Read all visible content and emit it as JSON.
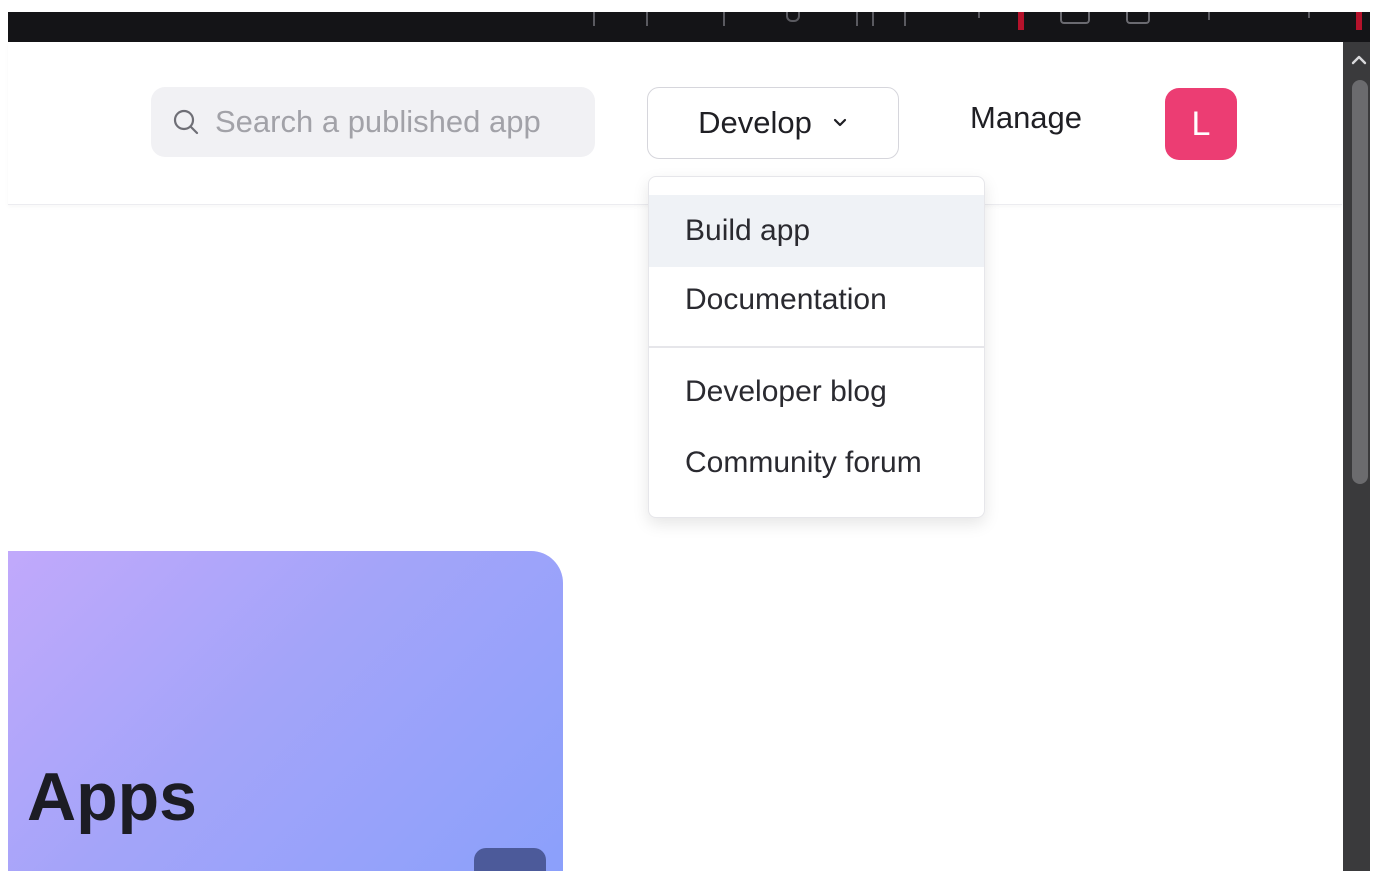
{
  "header": {
    "search": {
      "placeholder": "Search a published app",
      "value": "",
      "icon": "search-icon"
    },
    "develop_button": {
      "label": "Develop",
      "icon": "chevron-down-icon"
    },
    "manage_label": "Manage",
    "avatar_initial": "L",
    "avatar_color": "#ec3d73"
  },
  "develop_menu": {
    "items": [
      {
        "label": "Build app",
        "active": true
      },
      {
        "label": "Documentation",
        "active": false
      },
      {
        "label": "Developer blog",
        "active": false
      },
      {
        "label": "Community forum",
        "active": false
      }
    ]
  },
  "hero": {
    "title": "Apps",
    "gradient_colors": [
      "#c1a9fb",
      "#8aa0fb"
    ]
  },
  "colors": {
    "top_bar": "#141417",
    "scrollbar_track": "#3a3a3c",
    "scrollbar_thumb": "#6b6b6e"
  }
}
